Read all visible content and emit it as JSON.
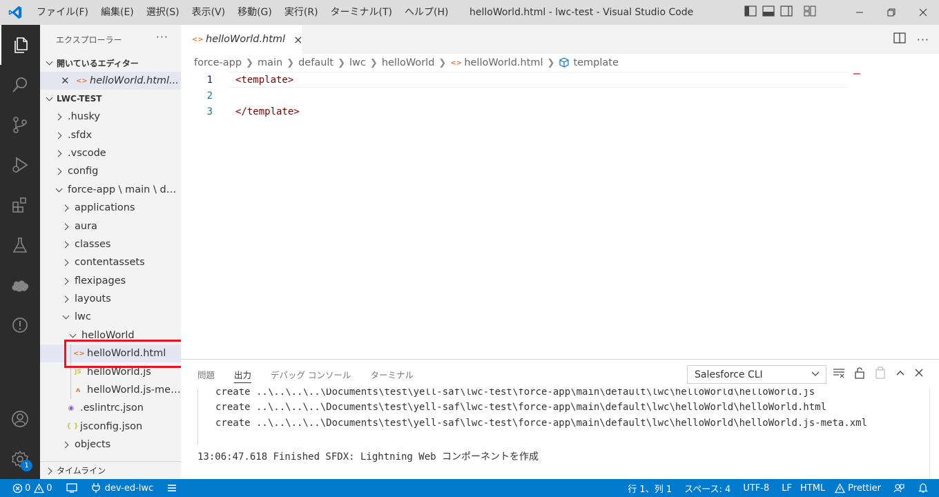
{
  "titlebar": {
    "menus": [
      "ファイル(F)",
      "編集(E)",
      "選択(S)",
      "表示(V)",
      "移動(G)",
      "実行(R)",
      "ターミナル(T)",
      "ヘルプ(H)"
    ],
    "window_title": "helloWorld.html - lwc-test - Visual Studio Code"
  },
  "activity": {
    "settings_badge": "1"
  },
  "sidebar": {
    "title": "エクスプローラー",
    "more": "···",
    "open_editors": {
      "header": "開いているエディター",
      "item": "helloWorld.html..."
    },
    "project": {
      "header": "LWC-TEST",
      "tree": [
        {
          "label": ".husky",
          "icon": "chevron-right"
        },
        {
          "label": ".sfdx",
          "icon": "chevron-right"
        },
        {
          "label": ".vscode",
          "icon": "chevron-right"
        },
        {
          "label": "config",
          "icon": "chevron-right"
        },
        {
          "label": "force-app \\ main \\ def...",
          "icon": "chevron-down"
        },
        {
          "label": "applications",
          "icon": "chevron-right"
        },
        {
          "label": "aura",
          "icon": "chevron-right"
        },
        {
          "label": "classes",
          "icon": "chevron-right"
        },
        {
          "label": "contentassets",
          "icon": "chevron-right"
        },
        {
          "label": "flexipages",
          "icon": "chevron-right"
        },
        {
          "label": "layouts",
          "icon": "chevron-right"
        },
        {
          "label": "lwc",
          "icon": "chevron-down"
        },
        {
          "label": "helloWorld",
          "icon": "chevron-down"
        },
        {
          "label": "helloWorld.html",
          "icon": "html-file-icon"
        },
        {
          "label": "helloWorld.js",
          "icon": "js-file-icon"
        },
        {
          "label": "helloWorld.js-met...",
          "icon": "xml-file-icon"
        },
        {
          "label": ".eslintrc.json",
          "icon": "eslint-file-icon"
        },
        {
          "label": "jsconfig.json",
          "icon": "json-file-icon"
        },
        {
          "label": "objects",
          "icon": "chevron-right"
        }
      ]
    },
    "timeline": "タイムライン"
  },
  "tabs": {
    "active": "helloWorld.html",
    "close": "×"
  },
  "breadcrumbs": [
    "force-app",
    "main",
    "default",
    "lwc",
    "helloWorld",
    "helloWorld.html",
    "template"
  ],
  "editor": {
    "lines": [
      {
        "num": "1",
        "text": "<template>"
      },
      {
        "num": "2",
        "text": ""
      },
      {
        "num": "3",
        "text": "</template>"
      }
    ]
  },
  "panel": {
    "tabs": [
      "問題",
      "出力",
      "デバッグ コンソール",
      "ターミナル"
    ],
    "active_tab": "出力",
    "output_channel": "Salesforce CLI",
    "output_lines": [
      "create ..\\..\\..\\..\\Documents\\test\\yell-saf\\lwc-test\\force-app\\main\\default\\lwc\\helloWorld\\helloWorld.js",
      "create ..\\..\\..\\..\\Documents\\test\\yell-saf\\lwc-test\\force-app\\main\\default\\lwc\\helloWorld\\helloWorld.html",
      "create ..\\..\\..\\..\\Documents\\test\\yell-saf\\lwc-test\\force-app\\main\\default\\lwc\\helloWorld\\helloWorld.js-meta.xml"
    ],
    "finished_line": "13:06:47.618 Finished SFDX: Lightning Web コンポーネントを作成"
  },
  "statusbar": {
    "errors": "0",
    "warnings": "0",
    "org": "dev-ed-lwc",
    "position": "行 1、列 1",
    "spaces": "スペース: 4",
    "encoding": "UTF-8",
    "eol": "LF",
    "language": "HTML",
    "prettier": "Prettier"
  },
  "colors": {
    "accent": "#007acc",
    "highlight_box": "#e81123",
    "activity_bg": "#2c2c2c",
    "title_bg": "#dddddd"
  }
}
